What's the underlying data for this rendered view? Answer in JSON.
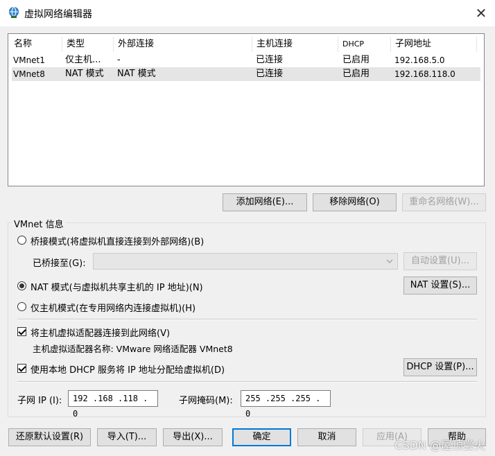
{
  "window": {
    "title": "虚拟网络编辑器",
    "close_glyph": "✕"
  },
  "network_table": {
    "columns": [
      "名称",
      "类型",
      "外部连接",
      "主机连接",
      "DHCP",
      "子网地址"
    ],
    "rows": [
      [
        "VMnet1",
        "仅主机...",
        "-",
        "已连接",
        "已启用",
        "192.168.5.0"
      ],
      [
        "VMnet8",
        "NAT 模式",
        "NAT 模式",
        "已连接",
        "已启用",
        "192.168.118.0"
      ]
    ],
    "selected_row": 1
  },
  "list_buttons": {
    "add": "添加网络(E)...",
    "remove": "移除网络(O)",
    "rename": "重命名网络(W)..."
  },
  "vmnet_info": {
    "legend": "VMnet 信息",
    "bridged_radio": "桥接模式(将虚拟机直接连接到外部网络)(B)",
    "bridged_to_label": "已桥接至(G):",
    "bridged_to_value": "",
    "auto_settings_button": "自动设置(U)...",
    "nat_radio": "NAT 模式(与虚拟机共享主机的 IP 地址)(N)",
    "nat_settings_button": "NAT 设置(S)...",
    "hostonly_radio": "仅主机模式(在专用网络内连接虚拟机)(H)",
    "selected_mode": "nat",
    "connect_adapter_checkbox": "将主机虚拟适配器连接到此网络(V)",
    "connect_adapter_checked": true,
    "adapter_name_text": "主机虚拟适配器名称: VMware 网络适配器 VMnet8",
    "dhcp_checkbox": "使用本地 DHCP 服务将 IP 地址分配给虚拟机(D)",
    "dhcp_checked": true,
    "dhcp_settings_button": "DHCP 设置(P)...",
    "subnet_ip_label": "子网 IP (I):",
    "subnet_ip_value": "192 .168 .118 . 0",
    "subnet_mask_label": "子网掩码(M):",
    "subnet_mask_value": "255 .255 .255 . 0"
  },
  "footer_buttons": {
    "restore": "还原默认设置(R)",
    "import": "导入(T)...",
    "export": "导出(X)...",
    "ok": "确定",
    "cancel": "取消",
    "apply": "应用(A)",
    "help": "帮助"
  },
  "watermark": "CSDN @屋顶尝火",
  "colors": {
    "accent": "#0078d7",
    "selected_row": "#e5e5e5",
    "disabled_text": "#a0a0a0"
  }
}
